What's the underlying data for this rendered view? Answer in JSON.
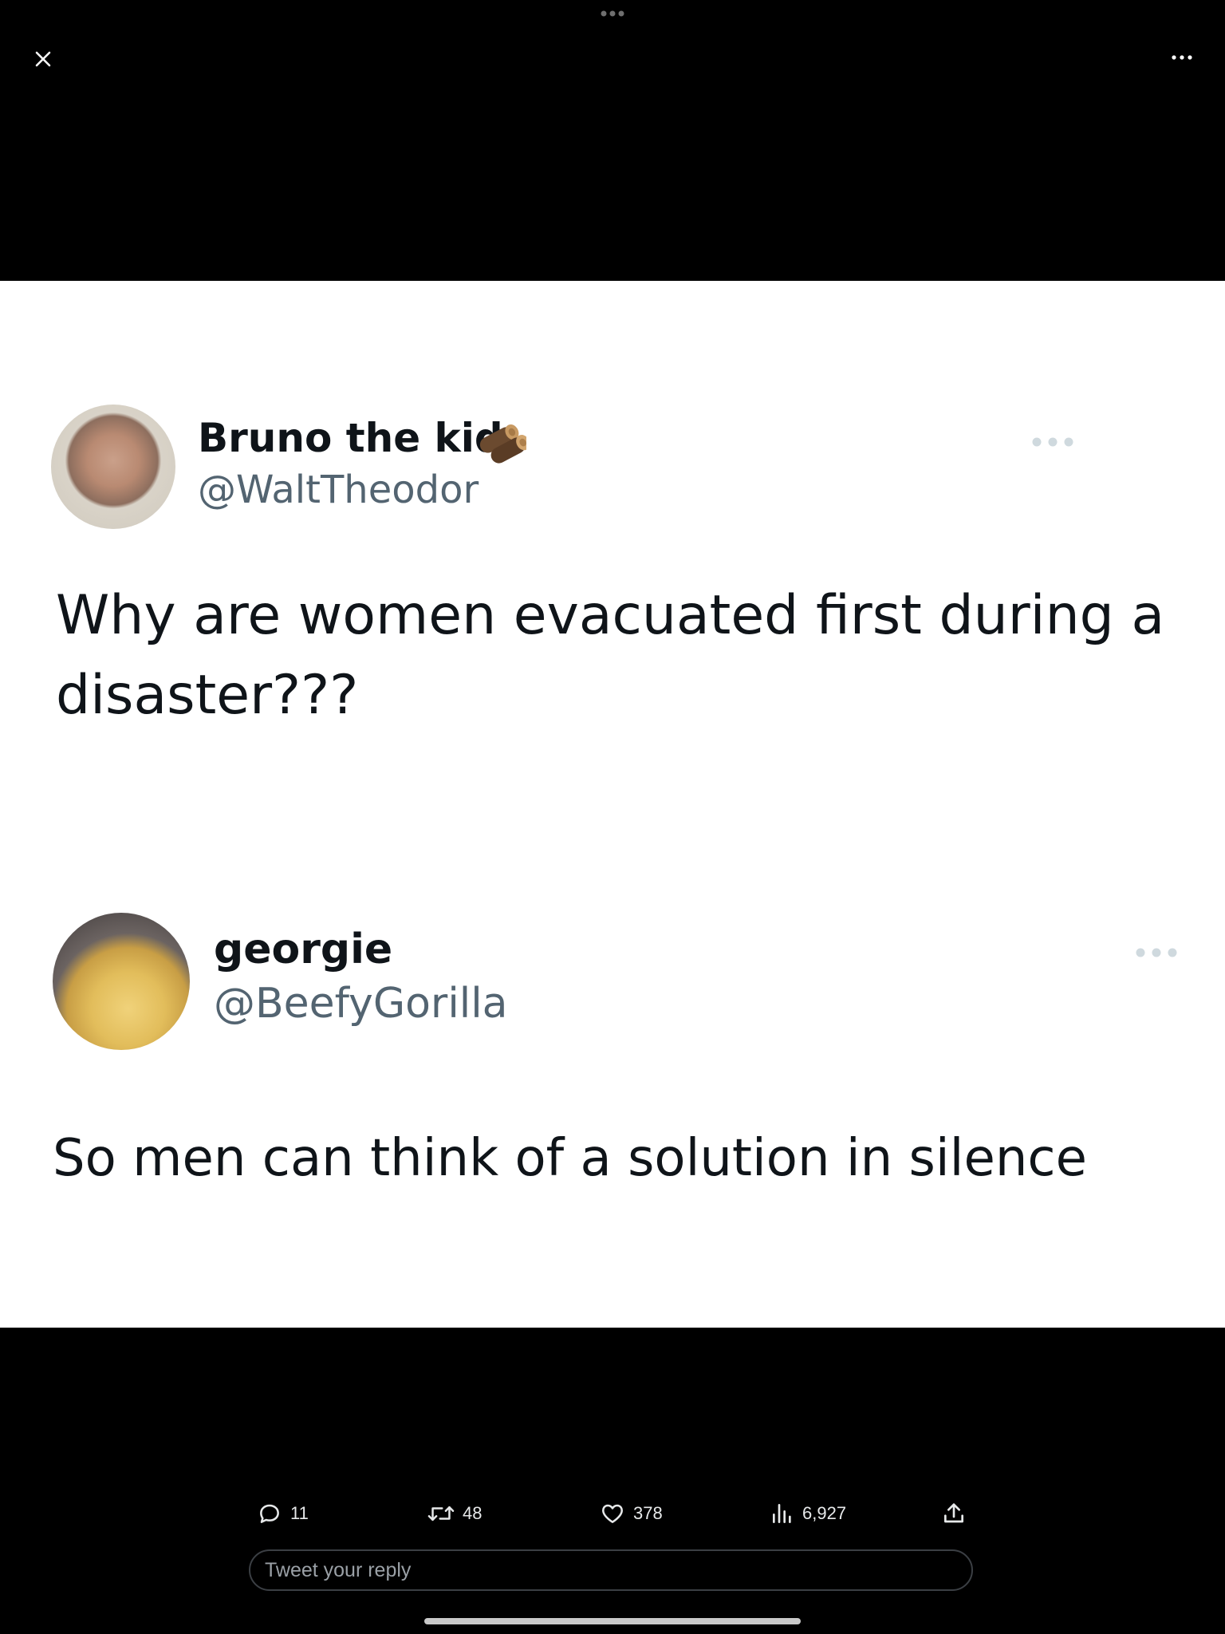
{
  "top_bar": {
    "close_icon": "close-icon",
    "more_icon": "more-horizontal-icon",
    "grabber_icon": "more-horizontal-icon"
  },
  "image": {
    "tweets": [
      {
        "display_name": "Bruno the kid",
        "handle": "@WaltTheodor",
        "emoji": "wood-logs-emoji",
        "text_lines": [
          "Why are women evacuated first during a",
          "disaster???"
        ]
      },
      {
        "display_name": "georgie",
        "handle": "@BeefyGorilla",
        "text_lines": [
          "So men can think of a solution in silence"
        ]
      }
    ]
  },
  "actions": {
    "reply": {
      "icon": "reply-icon",
      "count": "11"
    },
    "retweet": {
      "icon": "retweet-icon",
      "count": "48"
    },
    "like": {
      "icon": "heart-icon",
      "count": "378"
    },
    "views": {
      "icon": "views-chart-icon",
      "count": "6,927"
    },
    "share": {
      "icon": "share-icon"
    }
  },
  "reply_box": {
    "placeholder": "Tweet your reply"
  },
  "colors": {
    "background": "#000000",
    "panel": "#ffffff",
    "text_primary": "#0f1419",
    "text_secondary": "#536471",
    "action_text": "#e7e9ea"
  }
}
